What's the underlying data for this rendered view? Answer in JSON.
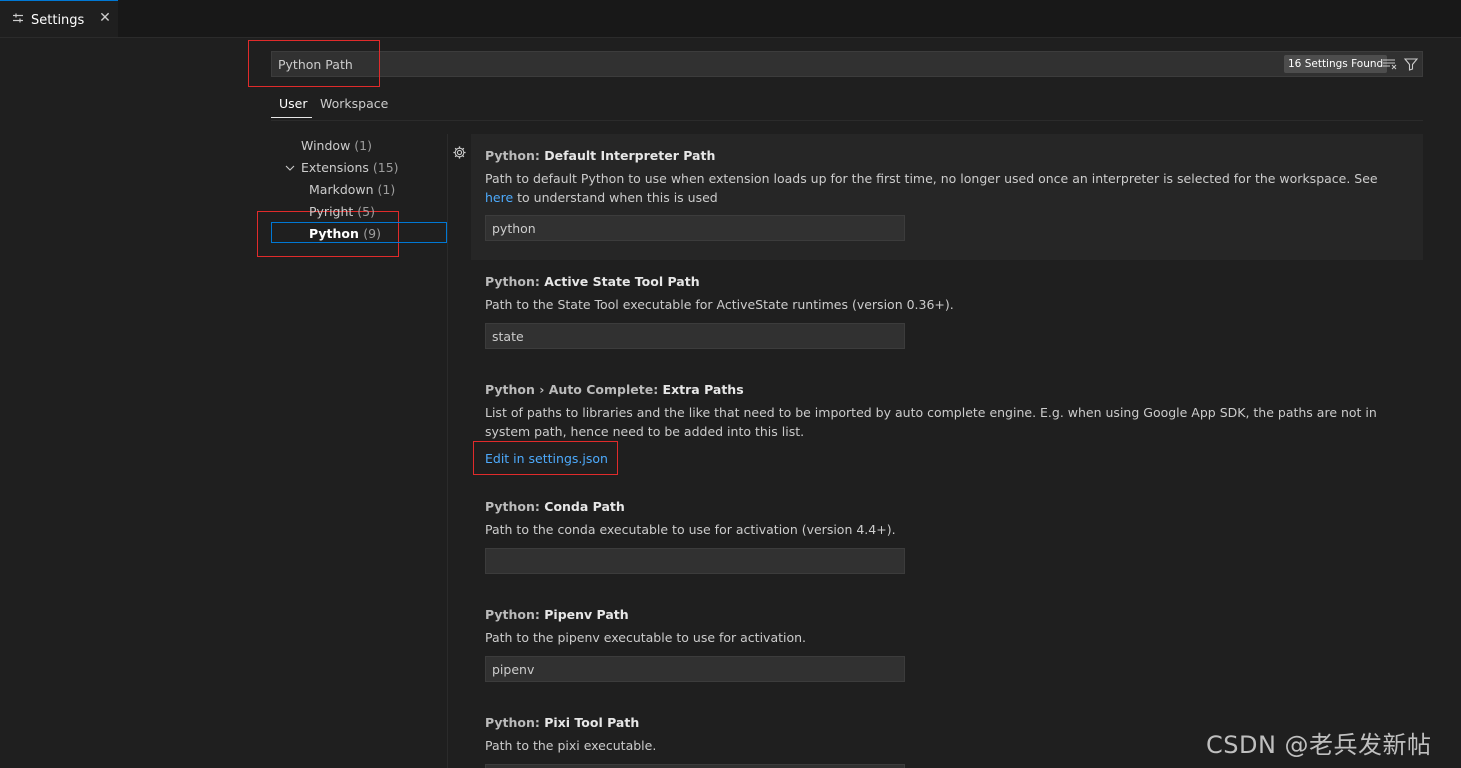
{
  "tab": {
    "label": "Settings",
    "close": "✕"
  },
  "search": {
    "value": "Python Path",
    "found": "16 Settings Found"
  },
  "scope_tabs": [
    {
      "label": "User"
    },
    {
      "label": "Workspace"
    }
  ],
  "toc": [
    {
      "label": "Window",
      "count": "(1)"
    },
    {
      "label": "Extensions",
      "count": "(15)"
    },
    {
      "label": "Markdown",
      "count": "(1)"
    },
    {
      "label": "Pyright",
      "count": "(5)"
    },
    {
      "label": "Python",
      "count": "(9)"
    }
  ],
  "settings": [
    {
      "category": "Python: ",
      "key": "Default Interpreter Path",
      "desc": "Path to default Python to use when extension loads up for the first time, no longer used once an interpreter is selected for the workspace. See ",
      "desc_link": "here",
      "desc_after": " to understand when this is used",
      "value": "python"
    },
    {
      "category": "Python: ",
      "key": "Active State Tool Path",
      "desc": "Path to the State Tool executable for ActiveState runtimes (version 0.36+).",
      "value": "state"
    },
    {
      "category": "Python › Auto Complete: ",
      "key": "Extra Paths",
      "desc": "List of paths to libraries and the like that need to be imported by auto complete engine. E.g. when using Google App SDK, the paths are not in system path, hence need to be added into this list.",
      "link": "Edit in settings.json"
    },
    {
      "category": "Python: ",
      "key": "Conda Path",
      "desc": "Path to the conda executable to use for activation (version 4.4+).",
      "value": ""
    },
    {
      "category": "Python: ",
      "key": "Pipenv Path",
      "desc": "Path to the pipenv executable to use for activation.",
      "value": "pipenv"
    },
    {
      "category": "Python: ",
      "key": "Pixi Tool Path",
      "desc": "Path to the pixi executable."
    }
  ],
  "watermark": "CSDN @老兵发新帖",
  "colors": {
    "accent": "#0078d4",
    "link": "#4daafc",
    "annotation": "#e02b2b"
  }
}
